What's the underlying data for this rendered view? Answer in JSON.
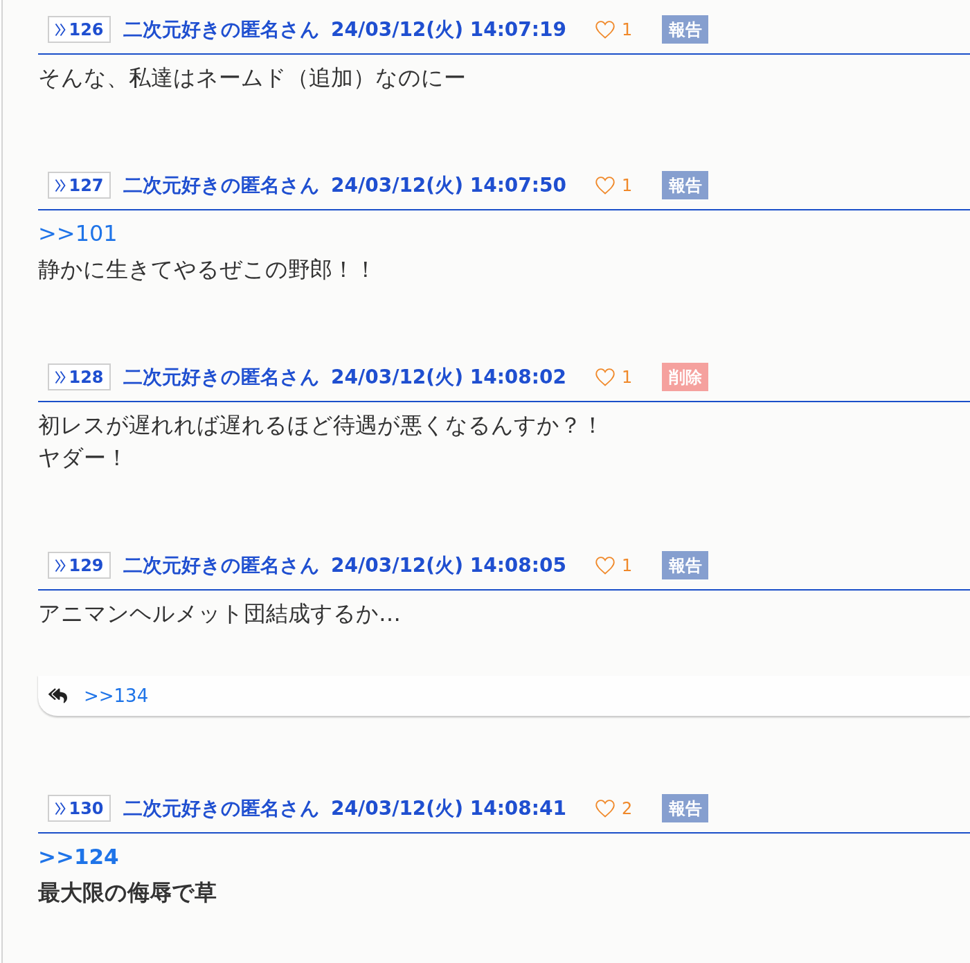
{
  "posts": [
    {
      "number": "126",
      "name": "二次元好きの匿名さん",
      "date": "24/03/12(火) 14:07:19",
      "likes": "1",
      "action": {
        "kind": "report",
        "label": "報告"
      },
      "body": [
        {
          "kind": "text",
          "bold": false,
          "text": "そんな、私達はネームド（追加）なのにー"
        }
      ]
    },
    {
      "number": "127",
      "name": "二次元好きの匿名さん",
      "date": "24/03/12(火) 14:07:50",
      "likes": "1",
      "action": {
        "kind": "report",
        "label": "報告"
      },
      "body": [
        {
          "kind": "anchor",
          "bold": false,
          "text": ">>101"
        },
        {
          "kind": "text",
          "bold": false,
          "text": "静かに生きてやるぜこの野郎！！"
        }
      ]
    },
    {
      "number": "128",
      "name": "二次元好きの匿名さん",
      "date": "24/03/12(火) 14:08:02",
      "likes": "1",
      "action": {
        "kind": "delete",
        "label": "削除"
      },
      "body": [
        {
          "kind": "text",
          "bold": false,
          "text": "初レスが遅れれば遅れるほど待遇が悪くなるんすか？！"
        },
        {
          "kind": "text",
          "bold": false,
          "text": "ヤダー！"
        }
      ]
    },
    {
      "number": "129",
      "name": "二次元好きの匿名さん",
      "date": "24/03/12(火) 14:08:05",
      "likes": "1",
      "action": {
        "kind": "report",
        "label": "報告"
      },
      "body": [
        {
          "kind": "text",
          "bold": false,
          "text": "アニマンヘルメット団結成するか…"
        }
      ],
      "replies": [
        ">>134"
      ]
    },
    {
      "number": "130",
      "name": "二次元好きの匿名さん",
      "date": "24/03/12(火) 14:08:41",
      "likes": "2",
      "action": {
        "kind": "report",
        "label": "報告"
      },
      "body": [
        {
          "kind": "anchor",
          "bold": true,
          "text": ">>124"
        },
        {
          "kind": "text",
          "bold": true,
          "text": "最大限の侮辱で草"
        }
      ]
    }
  ]
}
